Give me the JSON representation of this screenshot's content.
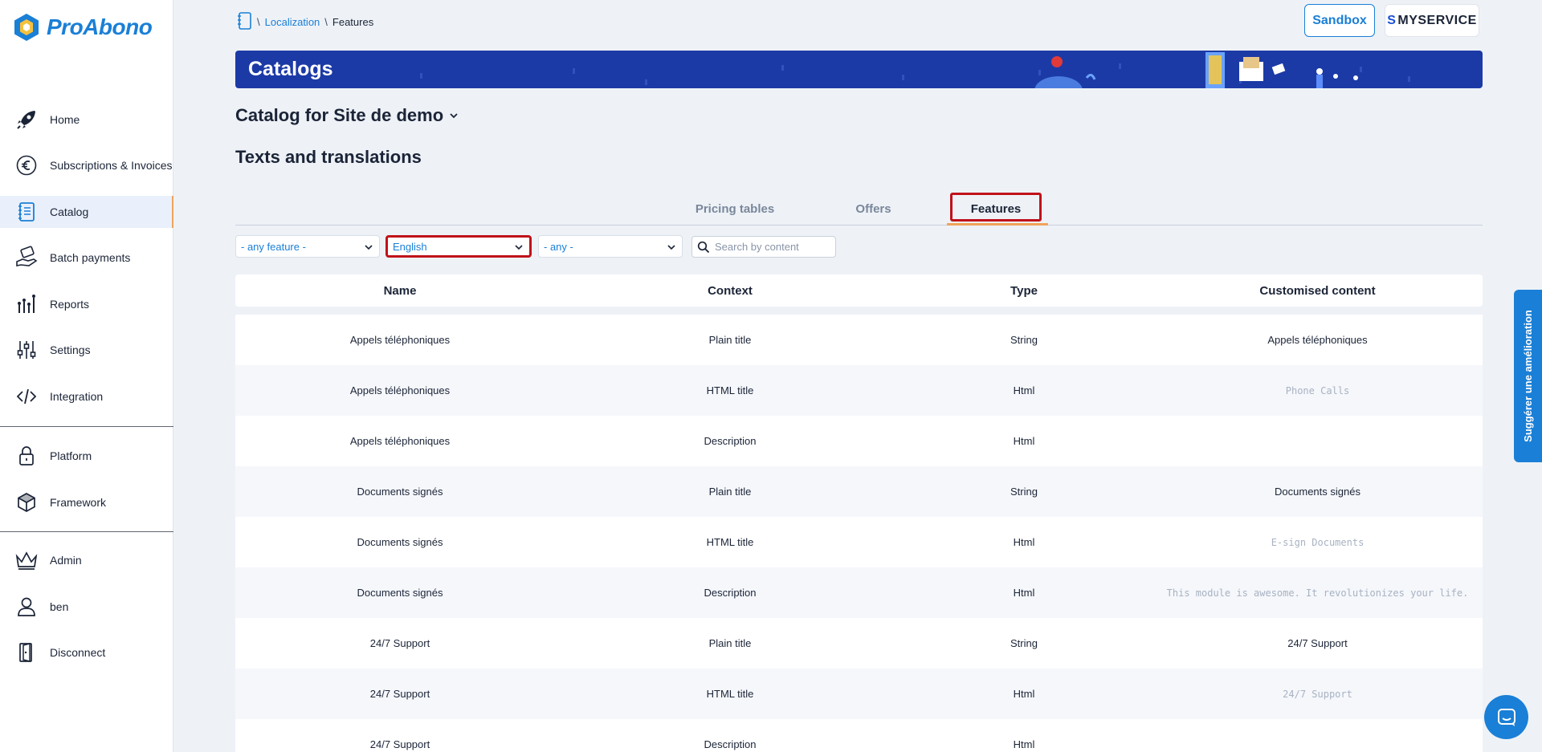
{
  "brand": {
    "name": "ProAbono"
  },
  "sidebar": {
    "items": [
      {
        "label": "Home",
        "icon": "rocket-icon"
      },
      {
        "label": "Subscriptions & Invoices",
        "icon": "euro-icon"
      },
      {
        "label": "Catalog",
        "icon": "notebook-icon",
        "active": true
      },
      {
        "label": "Batch payments",
        "icon": "hand-money-icon"
      },
      {
        "label": "Reports",
        "icon": "chart-icon"
      },
      {
        "label": "Settings",
        "icon": "sliders-icon"
      },
      {
        "label": "Integration",
        "icon": "code-icon"
      },
      {
        "label": "Platform",
        "icon": "lock-icon"
      },
      {
        "label": "Framework",
        "icon": "cube-icon"
      },
      {
        "label": "Admin",
        "icon": "crown-icon"
      },
      {
        "label": "ben",
        "icon": "user-icon"
      },
      {
        "label": "Disconnect",
        "icon": "door-icon"
      }
    ]
  },
  "header": {
    "breadcrumb": {
      "sep1": "\\",
      "link": "Localization",
      "sep2": "\\",
      "current": "Features"
    },
    "sandbox_label": "Sandbox",
    "brand_badge": {
      "first": "S",
      "rest": "MYSERVICE"
    }
  },
  "banner": {
    "title": "Catalogs"
  },
  "catalog_title": "Catalog for Site de demo",
  "section_title": "Texts and translations",
  "tabs": [
    {
      "label": "Pricing tables"
    },
    {
      "label": "Offers"
    },
    {
      "label": "Features",
      "active": true
    }
  ],
  "filters": {
    "feature": "- any feature -",
    "language": "English",
    "type": "- any -",
    "search_placeholder": "Search by content"
  },
  "table": {
    "headers": [
      "Name",
      "Context",
      "Type",
      "Customised content"
    ],
    "rows": [
      {
        "name": "Appels téléphoniques",
        "context": "Plain title",
        "type": "String",
        "content": "Appels téléphoniques",
        "placeholder": false
      },
      {
        "name": "Appels téléphoniques",
        "context": "HTML title",
        "type": "Html",
        "content": "Phone Calls",
        "placeholder": true
      },
      {
        "name": "Appels téléphoniques",
        "context": "Description",
        "type": "Html",
        "content": "",
        "placeholder": false
      },
      {
        "name": "Documents signés",
        "context": "Plain title",
        "type": "String",
        "content": "Documents signés",
        "placeholder": false
      },
      {
        "name": "Documents signés",
        "context": "HTML title",
        "type": "Html",
        "content": "E-sign Documents",
        "placeholder": true
      },
      {
        "name": "Documents signés",
        "context": "Description",
        "type": "Html",
        "content": "This module is awesome. It revolutionizes your life.",
        "placeholder": true
      },
      {
        "name": "24/7 Support",
        "context": "Plain title",
        "type": "String",
        "content": "24/7 Support",
        "placeholder": false
      },
      {
        "name": "24/7 Support",
        "context": "HTML title",
        "type": "Html",
        "content": "24/7 Support",
        "placeholder": true
      },
      {
        "name": "24/7 Support",
        "context": "Description",
        "type": "Html",
        "content": "",
        "placeholder": false
      }
    ]
  },
  "suggest_label": "Suggérer une amélioration",
  "colors": {
    "accent": "#1a7fd6",
    "banner": "#1c3aa6",
    "highlight": "#c0121a",
    "tab_underline": "#f0a35a"
  }
}
